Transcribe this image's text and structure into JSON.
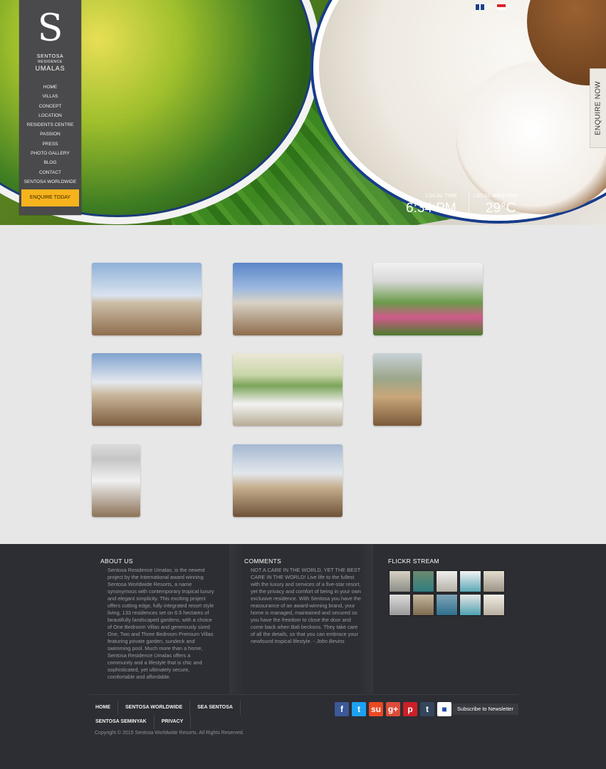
{
  "brand": {
    "line1": "SENTOSA",
    "line2": "RESIDENCE",
    "line3": "UMALAS",
    "logo_glyph": "S"
  },
  "nav": {
    "items": [
      "HOME",
      "VILLAS",
      "CONCEPT",
      "LOCATION",
      "RESIDENTS CENTRE",
      "PASSION",
      "PRESS",
      "PHOTO GALLERY",
      "BLOG",
      "CONTACT",
      "SENTOSA WORLDWIDE"
    ],
    "cta": "ENQUIRE TODAY"
  },
  "languages": [
    {
      "label": "EN",
      "flag": "flag-en"
    },
    {
      "label": "ID",
      "flag": "flag-id"
    }
  ],
  "widgets": {
    "time_label": "LOCAL TIME",
    "time": "6:34 PM",
    "weather_label": "LOCAL WEATHER",
    "weather": "29°C"
  },
  "enquire_now": "ENQUIRE NOW",
  "gallery": {
    "items": [
      {
        "alt": "gallery-photo-1"
      },
      {
        "alt": "gallery-photo-2"
      },
      {
        "alt": "gallery-photo-3"
      },
      {
        "alt": "gallery-photo-4"
      },
      {
        "alt": "gallery-photo-5"
      },
      {
        "alt": "gallery-photo-6"
      },
      {
        "alt": "gallery-photo-7"
      },
      {
        "alt": "gallery-photo-8"
      }
    ]
  },
  "footer": {
    "about": {
      "title": "ABOUT US",
      "text": "Sentosa Residence Umalas, is the newest project by the International award winning Sentosa Worldwide Resorts, a name synonymous with contemporary tropical luxury and elegant simplicity. This exciting project offers cutting edge, fully integrated resort style living, 133 residences set on 6.5 hectares of beautifully landscaped gardens, with a choice of One Bedroom Villas and generously sized One, Two and Three Bedroom Premium Villas featuring private garden, sundeck and swimming pool. Much more than a home, Sentosa Residence Umalas offers a community and a lifestyle that is chic and sophisticated, yet ultimately secure, comfortable and affordable."
    },
    "comments": {
      "title": "COMMENTS",
      "text": "NOT A CARE IN THE WORLD, YET THE BEST CARE IN THE WORLD! Live life to the fullest with the luxury and services of a five-star resort, yet the privacy and comfort of being in your own exclusive residence. With Sentosa you have the reassurance of an award-winning brand, your home is managed, maintained and secured so you have the freedom to close the door and come back when Bali beckons. They take care of all the details, so that you can embrace your newfound tropical lifestyle. - ",
      "author": "John Bevins"
    },
    "flickr": {
      "title": "FLICKR STREAM"
    },
    "links_row1": [
      "HOME",
      "SENTOSA WORLDWIDE",
      "SEA SENTOSA"
    ],
    "links_row2": [
      "SENTOSA SEMINYAK",
      "PRIVACY"
    ],
    "social": [
      {
        "icon": "facebook-icon",
        "glyph": "f"
      },
      {
        "icon": "twitter-icon",
        "glyph": "t"
      },
      {
        "icon": "stumbleupon-icon",
        "glyph": "su"
      },
      {
        "icon": "google-plus-icon",
        "glyph": "g+"
      },
      {
        "icon": "pinterest-icon",
        "glyph": "p"
      },
      {
        "icon": "tumblr-icon",
        "glyph": "t"
      },
      {
        "icon": "delicious-icon",
        "glyph": "■"
      }
    ],
    "subscribe": "Subscribe to Newsletter",
    "copyright": "Copyright © 2015 Sentosa Worldwide Resorts. All Rights Reserved."
  }
}
